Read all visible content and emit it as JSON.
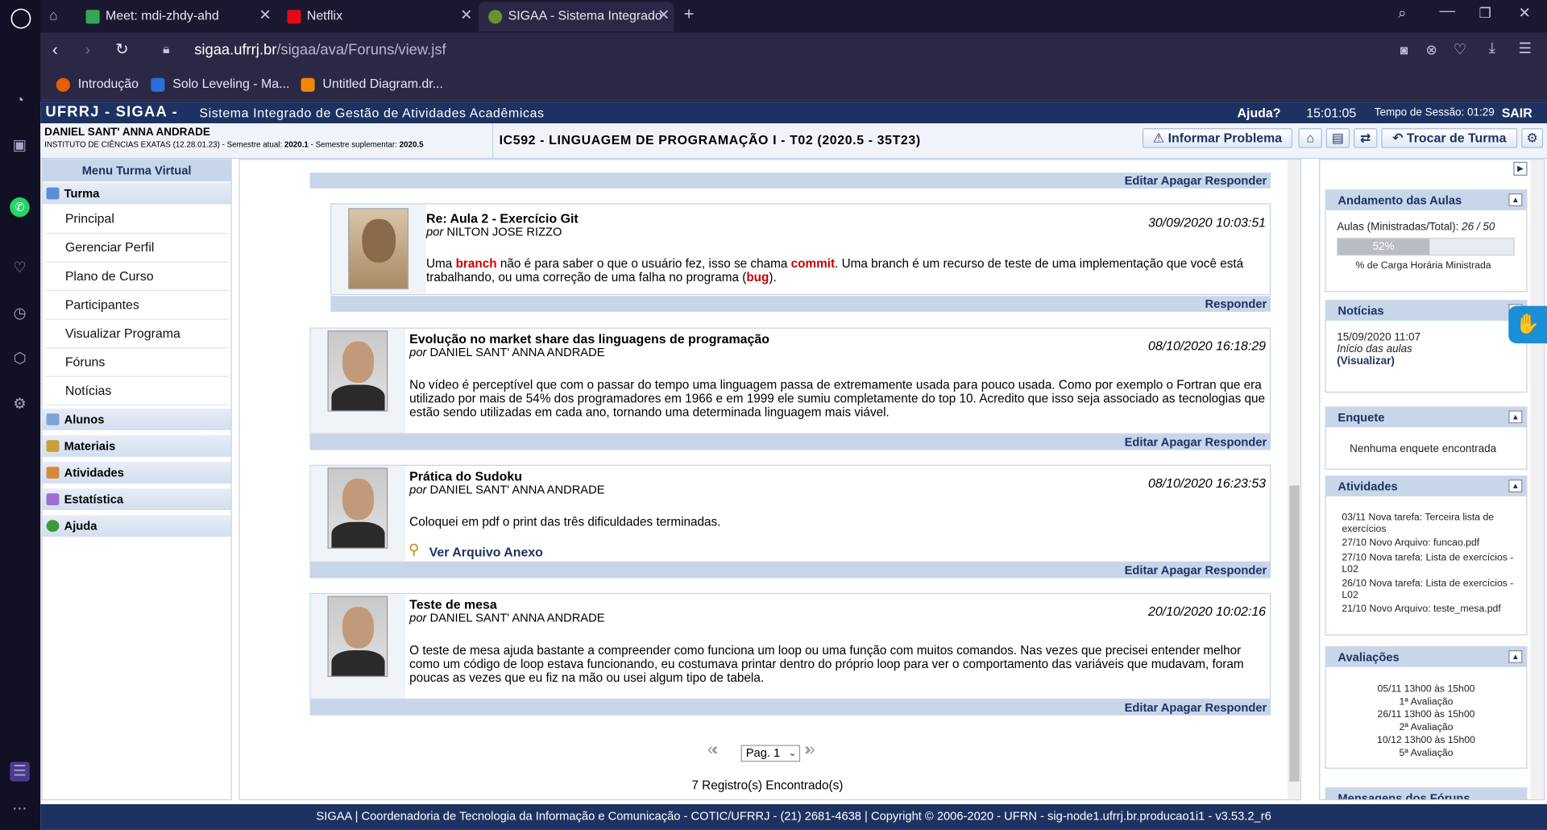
{
  "browser": {
    "tabs": [
      {
        "label": "Meet: mdi-zhdy-ahd"
      },
      {
        "label": "Netflix"
      },
      {
        "label": "SIGAA - Sistema Integrado"
      }
    ],
    "url_domain": "sigaa.ufrrj.br",
    "url_path": "/sigaa/ava/Foruns/view.jsf",
    "bookmarks": [
      "Introdução",
      "Solo Leveling - Ma...",
      "Untitled Diagram.dr..."
    ]
  },
  "header": {
    "brand": "UFRRJ - SIGAA -",
    "system": "Sistema Integrado de Gestão de Atividades Acadêmicas",
    "help": "Ajuda?",
    "clock": "15:01:05",
    "session": "Tempo de Sessão: 01:29",
    "exit": "SAIR"
  },
  "user": {
    "name": "DANIEL SANT' ANNA ANDRADE",
    "institute": "INSTITUTO DE CIÊNCIAS EXATAS (12.28.01.23) - Semestre atual:",
    "semester": "2020.1",
    "supl_label": "- Semestre suplementar:",
    "supl": "2020.5"
  },
  "course": "IC592 - LINGUAGEM DE PROGRAMAÇÃO I - T02 (2020.5 - 35T23)",
  "buttons": {
    "report": "Informar Problema",
    "change_class": "Trocar de Turma"
  },
  "menu": {
    "title": "Menu Turma Virtual",
    "turma": "Turma",
    "items": [
      "Principal",
      "Gerenciar Perfil",
      "Plano de Curso",
      "Participantes",
      "Visualizar Programa",
      "Fóruns",
      "Notícias"
    ],
    "groups": [
      "Alunos",
      "Materiais",
      "Atividades",
      "Estatística",
      "Ajuda"
    ]
  },
  "actions": {
    "edit": "Editar",
    "delete": "Apagar",
    "reply": "Responder"
  },
  "posts": [
    {
      "title": "Re: Aula 2 - Exercício Git",
      "by_label": "por",
      "author": "NILTON JOSE RIZZO",
      "date": "30/09/2020 10:03:51",
      "body_1": "Uma ",
      "kw1": "branch",
      "body_2": " não é para saber o que o usuário fez, isso se chama ",
      "kw2": "commit",
      "body_3": ". Uma branch é um recurso de teste de uma implementação que você está trabalhando, ou uma correção de uma falha no programa (",
      "kw3": "bug",
      "body_4": ")."
    },
    {
      "title": "Evolução no market share das linguagens de programação",
      "by_label": "por",
      "author": "DANIEL SANT' ANNA ANDRADE",
      "date": "08/10/2020 16:18:29",
      "body": "No vídeo é perceptível que com o passar do tempo uma linguagem passa de extremamente usada para pouco usada. Como por exemplo o Fortran que era utilizado por mais de 54% dos programadores em 1966 e em 1999 ele sumiu completamente do top 10. Acredito que isso seja associado as tecnologias que estão sendo utilizadas em cada ano, tornando uma determinada linguagem mais viável."
    },
    {
      "title": "Prática do Sudoku",
      "by_label": "por",
      "author": "DANIEL SANT' ANNA ANDRADE",
      "date": "08/10/2020 16:23:53",
      "body": "Coloquei em pdf o print das três dificuldades terminadas.",
      "attachment": "Ver Arquivo Anexo"
    },
    {
      "title": "Teste de mesa",
      "by_label": "por",
      "author": "DANIEL SANT' ANNA ANDRADE",
      "date": "20/10/2020 10:02:16",
      "body": "O teste de mesa ajuda bastante a compreender como funciona um loop ou uma função com muitos comandos. Nas vezes que precisei entender melhor como um código de loop estava funcionando, eu costumava printar dentro do próprio loop para ver o comportamento das variáveis que mudavam, foram poucas as vezes que eu fiz na mão ou usei algum tipo de tabela."
    }
  ],
  "pagination": {
    "page": "Pag. 1",
    "records": "7 Registro(s) Encontrado(s)"
  },
  "right": {
    "progress": {
      "title": "Andamento das Aulas",
      "label": "Aulas (Ministradas/Total):",
      "value": "26 / 50",
      "percent": "52%",
      "percent_value": 0.52,
      "caption": "% de Carga Horária Ministrada"
    },
    "news": {
      "title": "Notícias",
      "date": "15/09/2020 11:07",
      "text": "Início das aulas",
      "link": "(Visualizar)"
    },
    "poll": {
      "title": "Enquete",
      "text": "Nenhuma enquete encontrada"
    },
    "activities": {
      "title": "Atividades",
      "items": [
        {
          "date": "03/11",
          "text": "Nova tarefa: Terceira lista de exercícios"
        },
        {
          "date": "27/10",
          "text": "Novo Arquivo: funcao.pdf"
        },
        {
          "date": "27/10",
          "text": "Nova tarefa: Lista de exercícios - L02"
        },
        {
          "date": "26/10",
          "text": "Nova tarefa: Lista de exercícios - L02"
        },
        {
          "date": "21/10",
          "text": "Novo Arquivo: teste_mesa.pdf"
        }
      ]
    },
    "evaluations": {
      "title": "Avaliações",
      "items": [
        {
          "when": "05/11 13h00 às 15h00",
          "name": "1ª Avaliação"
        },
        {
          "when": "26/11 13h00 às 15h00",
          "name": "2ª Avaliação"
        },
        {
          "when": "10/12 13h00 às 15h00",
          "name": "5ª Avaliação"
        }
      ]
    },
    "forum_msgs": {
      "title": "Mensagens dos Fóruns"
    }
  },
  "footer": "SIGAA | Coordenadoria de Tecnologia da Informação e Comunicação - COTIC/UFRRJ - (21) 2681-4638 | Copyright © 2006-2020 - UFRN - sig-node1.ufrrj.br.producao1i1 - v3.53.2_r6",
  "colors": {
    "sigaa_blue": "#1e3262",
    "panel": "#c8d6ea",
    "keyword_red": "#cc0000",
    "browser_bg": "#1c1a2e"
  }
}
